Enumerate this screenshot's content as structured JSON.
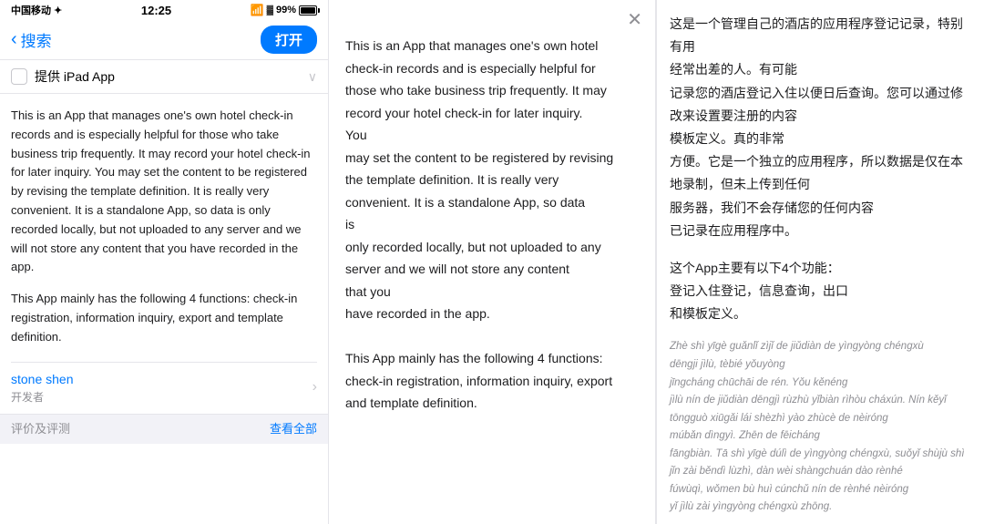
{
  "status_bar": {
    "carrier": "中国移动 ✦",
    "time": "12:25",
    "battery": "99%"
  },
  "nav": {
    "back_label": "搜索",
    "open_button": "打开"
  },
  "ipad_toggle": {
    "label": "提供 iPad App"
  },
  "left_description": {
    "paragraph1": "This is an App that manages one's own hotel check-in records and is especially helpful for those who take business trip frequently. It may record your hotel check-in for later inquiry. You may set the content to be registered by revising the template definition. It is really very convenient. It is a standalone App, so data is only recorded locally, but not uploaded to any server and we will not store any content that you have recorded in the app.",
    "paragraph2": "This App mainly has the following 4 functions: check-in registration, information inquiry, export and template definition."
  },
  "developer": {
    "name": "stone shen",
    "role": "开发者"
  },
  "review_bar": {
    "left": "评价及评测",
    "right": "查看全部"
  },
  "modal": {
    "paragraph1": "This is an App that manages one's own hotel",
    "paragraph2": "check-in records and is especially helpful for",
    "paragraph3": "those who take business trip frequently. It may",
    "paragraph4": "record your hotel check-in for later inquiry.",
    "paragraph5": "You",
    "paragraph6": "may set the content to be registered by revising",
    "paragraph7": "the template definition. It is really very",
    "paragraph8": "convenient. It is a standalone App, so data",
    "paragraph9": "is",
    "paragraph10": "only recorded locally, but not uploaded to any",
    "paragraph11": "server and we will not store any content",
    "paragraph12": "that you",
    "paragraph13": "have recorded in the app.",
    "paragraph14": "This App mainly has the following 4 functions:",
    "paragraph15": "check-in registration, information inquiry, export",
    "paragraph16": "and template definition."
  },
  "chinese": {
    "block1": "这是一个管理自己的酒店的应用程序登记记录，特别有用\n经常出差的人。有可能\n记录您的酒店登记入住以便日后查询。您可以通过修改来设置要注册的内容\n模板定义。真的非常\n方便。它是一个独立的应用程序，所以数据是仅在本地录制，但未上传到任何\n服务器，我们不会存储您的任何内容\n已记录在应用程序中。",
    "block2": "这个App主要有以下4个功能：\n登记入住登记，信息查询，出口\n和模板定义。",
    "pinyin": "Zhè shì yīgè guǎnlǐ zìjǐ de jiǔdiàn de yìngyòng chéngxù\ndēngji jìlù, tèbié yǒuyòng\njīngcháng chūchāi de rén. Yǒu kěnéng\njìlù nín de jiǔdiàn dēngjì rùzhù yǐbiàn rìhòu cháxún. Nín kěyǐ tōngguò xiūgǎi lái shèzhì yào zhùcè de nèiróng\nmúbǎn dìngyì. Zhēn de fēicháng\nfāngbiàn. Tā shì yīgè dúlì de yìngyòng chéngxù, suǒyǐ shùjù shì\njǐn zài běndì lùzhì, dàn wèi shàngchuán dào rènhé\nfúwùqì, wǒmen bù huì cúnchǔ nín de rènhé nèiróng\nyǐ jìlù zài yìngyòng chéngxù zhōng."
  }
}
